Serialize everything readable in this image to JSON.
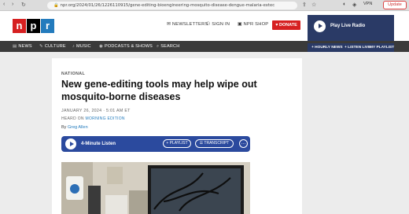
{
  "browser": {
    "url": "npr.org/2024/01/26/1226110915/gene-editing-bioengineering-mosquito-disease-dengue-malaria-extec",
    "vpn_label": "VPN",
    "update_label": "Update"
  },
  "header": {
    "logo": [
      "n",
      "p",
      "r"
    ],
    "newsletters": "NEWSLETTERS",
    "sign_in": "SIGN IN",
    "shop": "NPR SHOP",
    "donate": "DONATE",
    "live_radio": "Play Live Radio"
  },
  "nav": {
    "items": [
      "NEWS",
      "CULTURE",
      "MUSIC",
      "PODCASTS & SHOWS",
      "SEARCH"
    ],
    "live_sub": [
      "HOURLY NEWS",
      "LISTEN LIVE",
      "MY PLAYLIST"
    ]
  },
  "article": {
    "kicker": "NATIONAL",
    "headline": "New gene-editing tools may help wipe out mosquito-borne diseases",
    "date": "JANUARY 26, 2024 · 5:01 AM ET",
    "heard_on_prefix": "HEARD ON",
    "heard_on_program": "MORNING EDITION",
    "by_prefix": "By",
    "author": "Greg Allen"
  },
  "player": {
    "label": "4-Minute Listen",
    "playlist": "PLAYLIST",
    "transcript": "TRANSCRIPT"
  },
  "colors": {
    "npr_red": "#d62021",
    "npr_blue": "#237bbd",
    "player_blue": "#2b4a9e",
    "live_navy": "#2a3a66"
  }
}
